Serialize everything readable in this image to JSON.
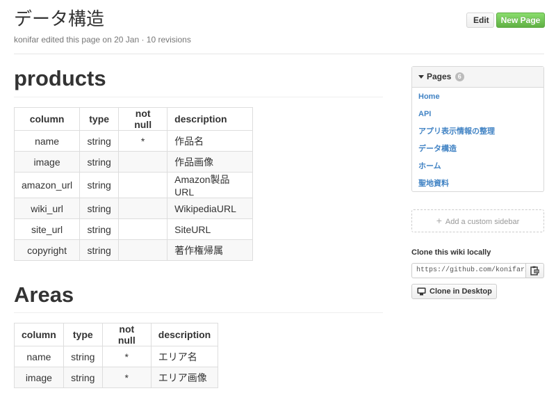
{
  "header": {
    "title": "データ構造",
    "meta": "konifar edited this page on 20 Jan · 10 revisions",
    "edit_label": "Edit",
    "new_page_label": "New Page"
  },
  "products": {
    "heading": "products",
    "columns": [
      "column",
      "type",
      "not null",
      "description"
    ],
    "rows": [
      [
        "name",
        "string",
        "*",
        "作品名"
      ],
      [
        "image",
        "string",
        "",
        "作品画像"
      ],
      [
        "amazon_url",
        "string",
        "",
        "Amazon製品URL"
      ],
      [
        "wiki_url",
        "string",
        "",
        "WikipediaURL"
      ],
      [
        "site_url",
        "string",
        "",
        "SiteURL"
      ],
      [
        "copyright",
        "string",
        "",
        "著作権帰属"
      ]
    ]
  },
  "areas": {
    "heading": "Areas",
    "columns": [
      "column",
      "type",
      "not null",
      "description"
    ],
    "rows": [
      [
        "name",
        "string",
        "*",
        "エリア名"
      ],
      [
        "image",
        "string",
        "*",
        "エリア画像"
      ]
    ]
  },
  "sidebar": {
    "pages_label": "Pages",
    "pages_count": "6",
    "pages": [
      "Home",
      "API",
      "アプリ表示情報の整理",
      "データ構造",
      "ホーム",
      "聖地資料"
    ],
    "add_sidebar_label": "Add a custom sidebar",
    "clone_label": "Clone this wiki locally",
    "clone_url": "https://github.com/konifar/",
    "clone_desktop_label": "Clone in Desktop"
  },
  "colors": {
    "link": "#4183c4",
    "new_page_button": "#6cc644"
  }
}
